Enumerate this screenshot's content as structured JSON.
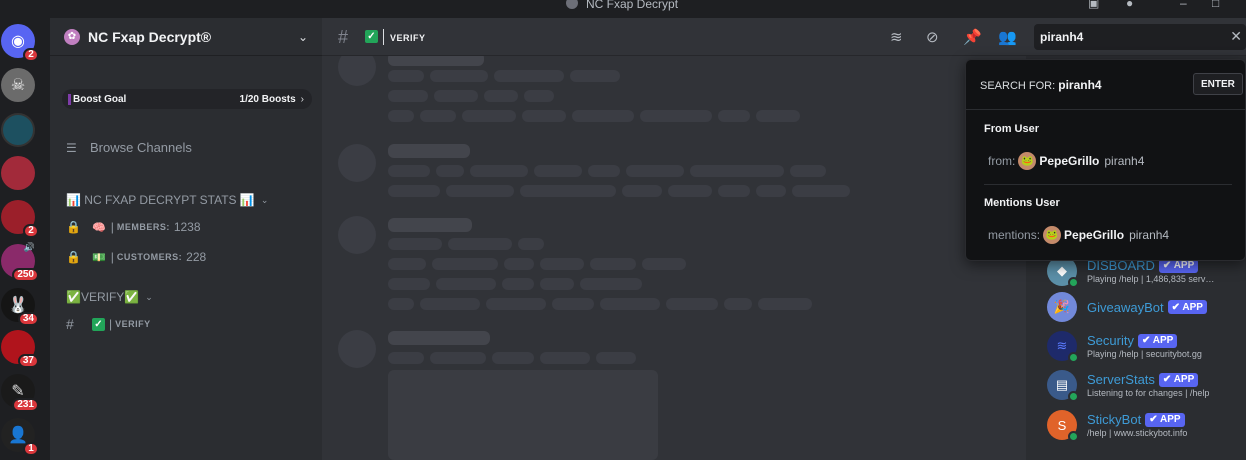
{
  "window": {
    "title": "NC Fxap Decrypt"
  },
  "servers": [
    {
      "name": "discord-home",
      "badge": "2",
      "color": "#5865f2",
      "glyph": "◉"
    },
    {
      "name": "server-skull",
      "badge": "",
      "color": "#6b6b6b",
      "glyph": "☠"
    },
    {
      "name": "server-teal",
      "badge": "",
      "color": "#1d5060",
      "glyph": ""
    },
    {
      "name": "server-red-pattern",
      "badge": "",
      "color": "#a22a3a",
      "glyph": ""
    },
    {
      "name": "server-red-splash",
      "badge": "2",
      "color": "#9b1f2a",
      "glyph": ""
    },
    {
      "name": "server-pink",
      "badge": "250",
      "color": "#8a2a6a",
      "glyph": ""
    },
    {
      "name": "server-bunny",
      "badge": "34",
      "color": "#151515",
      "glyph": "🐰"
    },
    {
      "name": "server-red-logo",
      "badge": "37",
      "color": "#b0141c",
      "glyph": ""
    },
    {
      "name": "server-dark",
      "badge": "231",
      "color": "#1a1a1a",
      "glyph": "✎"
    },
    {
      "name": "server-masked",
      "badge": "1",
      "color": "#222",
      "glyph": "👤"
    }
  ],
  "guild": {
    "name": "NC Fxap Decrypt®",
    "boost_label": "Boost Goal",
    "boost_progress": "1/20 Boosts",
    "browse": "Browse Channels"
  },
  "categories": [
    {
      "name": "📊 NC FXAP DECRYPT STATS 📊"
    },
    {
      "name": "✅VERIFY✅"
    }
  ],
  "channels": [
    {
      "emoji": "🧠",
      "label": "MEMBERS:",
      "value": "1238"
    },
    {
      "emoji": "💵",
      "label": "CUSTOMERS:",
      "value": "228"
    },
    {
      "label": "VERIFY"
    }
  ],
  "header": {
    "channel": "VERIFY",
    "search_value": "piranh4"
  },
  "search_popout": {
    "search_for_label": "SEARCH FOR:",
    "query": "piranh4",
    "enter": "ENTER",
    "from_title": "From User",
    "from_prefix": "from:",
    "mentions_title": "Mentions User",
    "mentions_prefix": "mentions:",
    "user_display": "PepeGrillo",
    "user_name": "piranh4"
  },
  "members": [
    {
      "name": "DISBOARD",
      "tag": "✔ APP",
      "activity": "Playing /help | 1,486,835 serv…",
      "color": "#5b8fa8",
      "glyph": "◆"
    },
    {
      "name": "GiveawayBot",
      "tag": "✔ APP",
      "activity": "",
      "color": "#7289da",
      "glyph": "🎉"
    },
    {
      "name": "Security",
      "tag": "✔ APP",
      "activity": "Playing /help | securitybot.gg",
      "color": "#1e2a6a",
      "glyph": "≋"
    },
    {
      "name": "ServerStats",
      "tag": "✔ APP",
      "activity": "Listening to for changes | /help",
      "color": "#3a5a8a",
      "glyph": "▤"
    },
    {
      "name": "StickyBot",
      "tag": "✔ APP",
      "activity": "/help | www.stickybot.info",
      "color": "#e0632a",
      "glyph": "S"
    }
  ]
}
